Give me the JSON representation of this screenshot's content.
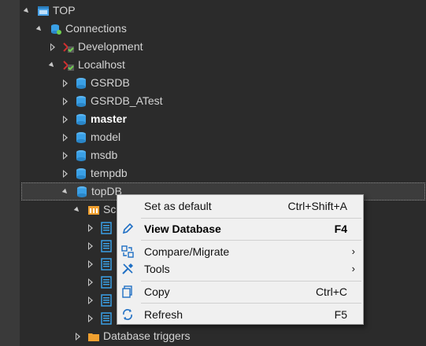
{
  "tree": {
    "root": {
      "label": "TOP"
    },
    "connections": {
      "label": "Connections"
    },
    "development": {
      "label": "Development"
    },
    "localhost": {
      "label": "Localhost"
    },
    "databases": [
      "GSRDB",
      "GSRDB_ATest",
      "master",
      "model",
      "msdb",
      "tempdb"
    ],
    "topdb": {
      "label": "topDB"
    },
    "schemas_partial": {
      "label": "Sc"
    },
    "db_triggers": {
      "label": "Database triggers"
    }
  },
  "context_menu": {
    "items": [
      {
        "label": "Set as default",
        "shortcut": "Ctrl+Shift+A",
        "icon": "none"
      },
      {
        "label": "View Database",
        "shortcut": "F4",
        "icon": "pencil-icon"
      },
      {
        "label": "Compare/Migrate",
        "submenu": "›",
        "icon": "compare-icon"
      },
      {
        "label": "Tools",
        "submenu": "›",
        "icon": "tools-icon"
      },
      {
        "label": "Copy",
        "shortcut": "Ctrl+C",
        "icon": "copy-icon"
      },
      {
        "label": "Refresh",
        "shortcut": "F5",
        "icon": "refresh-icon"
      }
    ]
  },
  "colors": {
    "background": "#2b2b2b",
    "db_icon": "#3aa0e6",
    "folder_icon": "#f0a030",
    "menu_bg": "#f0f0f0",
    "menu_icon": "#1f6fc4"
  }
}
